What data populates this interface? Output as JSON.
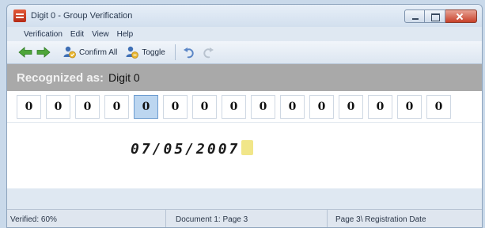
{
  "window": {
    "title": "Digit 0 - Group Verification"
  },
  "menu": [
    "Verification",
    "Edit",
    "View",
    "Help"
  ],
  "toolbar": {
    "back_icon": "back-arrow-icon",
    "forward_icon": "forward-arrow-icon",
    "confirm_all_label": "Confirm All",
    "toggle_label": "Toggle",
    "undo_icon": "undo-icon",
    "redo_icon": "redo-icon"
  },
  "recognized": {
    "label": "Recognized as:",
    "value": "Digit 0"
  },
  "thumbnails": {
    "items": [
      "0",
      "0",
      "0",
      "0",
      "0",
      "0",
      "0",
      "0",
      "0",
      "0",
      "0",
      "0",
      "0",
      "0",
      "0"
    ],
    "selected_index": 4
  },
  "document": {
    "handwritten_text": "07/05/2007"
  },
  "status": {
    "verified": "Verified: 60%",
    "document_page": "Document 1: Page 3",
    "field": "Page 3\\ Registration Date"
  },
  "colors": {
    "recognized_band": "#a9a9a9",
    "selected_thumb": "#bcd6f0",
    "highlight": "#e6d228",
    "arrow_green": "#4ea53a"
  }
}
